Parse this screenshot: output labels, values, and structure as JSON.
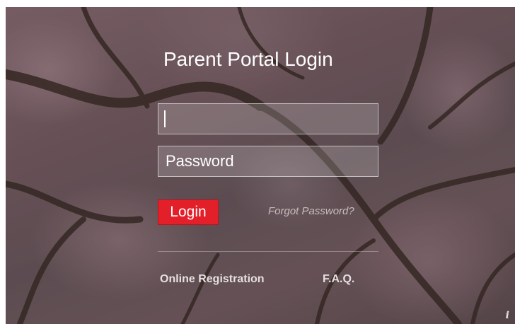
{
  "page": {
    "title": "Parent Portal Login"
  },
  "login_form": {
    "username_value": "",
    "password_placeholder": "Password",
    "login_label": "Login",
    "forgot_label": "Forgot Password?"
  },
  "footer_links": {
    "online_registration": "Online Registration",
    "faq": "F.A.Q."
  },
  "info": {
    "glyph": "i",
    "icon": "info-icon"
  },
  "colors": {
    "login_button": "#e3202a",
    "text": "#ffffff",
    "forgot_link": "#c9bcbf"
  }
}
